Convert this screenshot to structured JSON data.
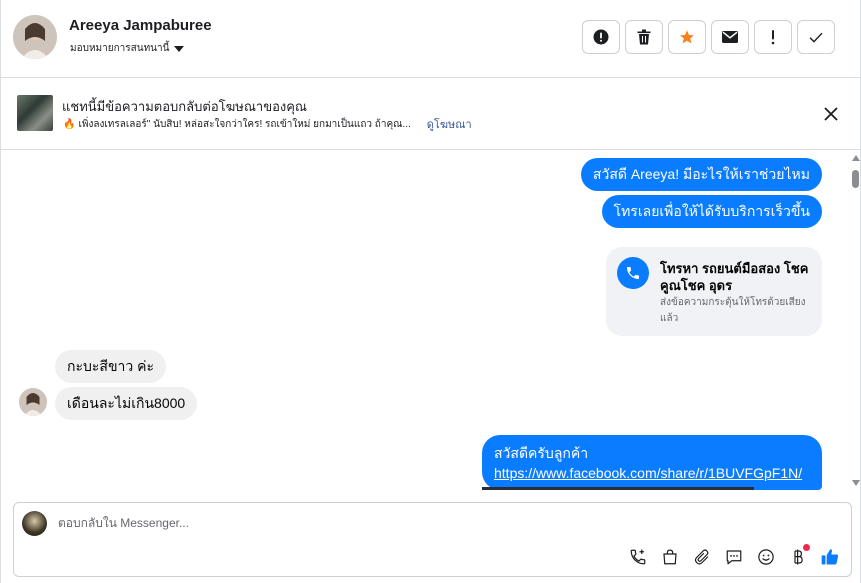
{
  "header": {
    "contact_name": "Areeya Jampaburee",
    "assign_label": "มอบหมายการสนทนานี้",
    "actions": [
      {
        "icon": "alert-circle-icon",
        "label": "!"
      },
      {
        "icon": "trash-icon",
        "label": ""
      },
      {
        "icon": "star-icon",
        "label": ""
      },
      {
        "icon": "envelope-icon",
        "label": ""
      },
      {
        "icon": "exclamation-icon",
        "label": "!"
      },
      {
        "icon": "check-icon",
        "label": ""
      }
    ],
    "star_color": "#f5821f"
  },
  "banner": {
    "title": "แชทนี้มีข้อความตอบกลับต่อโฆษณาของคุณ",
    "subtitle": "เพิ่งลงเทรลเลอร์\" นับสิบ! หล่อสะใจกว่าใคร! รถเข้าใหม่ ยกมาเป็นแถว ถ้าคุณ...",
    "link": "ดูโฆษณา"
  },
  "messages": {
    "out_1": "สวัสดี Areeya! มีอะไรให้เราช่วยไหม",
    "out_2": "โทรเลยเพื่อให้ได้รับบริการเร็วขึ้น",
    "call_card": {
      "title": "โทรหา รถยนต์มือสอง โชคคูณโชค อุดร",
      "subtitle": "ส่งข้อความกระตุ้นให้โทรด้วยเสียงแล้ว"
    },
    "in_1": "กะบะสีขาว ค่ะ",
    "in_2": "เดือนละไม่เกิน8000",
    "out_3_text": "สวัสดีครับลูกค้า",
    "out_3_url": "https://www.facebook.com/share/r/1BUVFGpF1N/"
  },
  "composer": {
    "placeholder": "ตอบกลับใน Messenger..."
  },
  "colors": {
    "accent": "#0a7cff",
    "incoming_bubble": "#f0f0f0",
    "badge": "#f02849"
  }
}
